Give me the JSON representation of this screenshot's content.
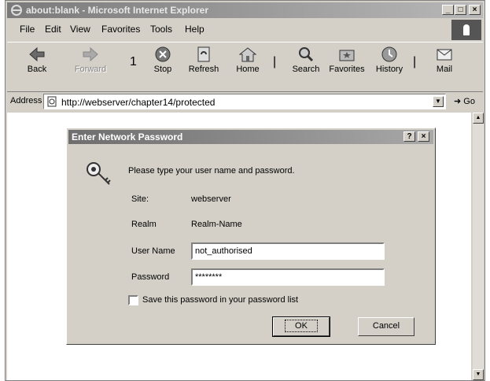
{
  "window": {
    "title": "about:blank - Microsoft Internet Explorer"
  },
  "menu": [
    "File",
    "Edit",
    "View",
    "Favorites",
    "Tools",
    "Help"
  ],
  "toolbar": {
    "back": "Back",
    "forward": "Forward",
    "stop": "Stop",
    "refresh": "Refresh",
    "home": "Home",
    "search": "Search",
    "favorites": "Favorites",
    "history": "History",
    "mail": "Mail",
    "marker": "1"
  },
  "address": {
    "label": "Address",
    "url": "http://webserver/chapter14/protected",
    "go": "Go"
  },
  "dialog": {
    "title": "Enter Network Password",
    "prompt": "Please type your user name and password.",
    "site_label": "Site:",
    "site_value": "webserver",
    "realm_label": "Realm",
    "realm_value": "Realm-Name",
    "username_label": "User Name",
    "username_value": "not_authorised",
    "password_label": "Password",
    "password_value": "********",
    "save_label": "Save this password in your password list",
    "ok": "OK",
    "cancel": "Cancel"
  }
}
